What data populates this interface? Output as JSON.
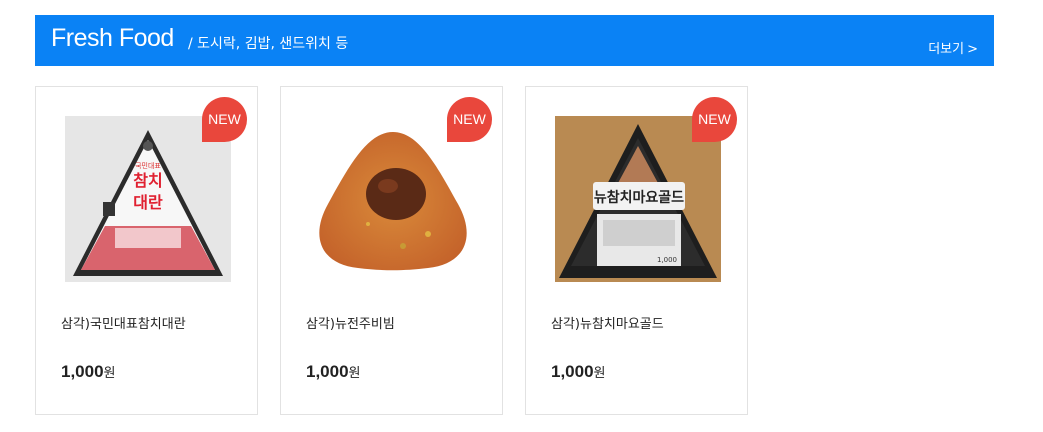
{
  "header": {
    "title": "Fresh Food",
    "subtitle": "/ 도시락, 김밥, 샌드위치 등",
    "more_label": "더보기",
    "more_chevron": ">"
  },
  "colors": {
    "header_bg": "#0a82f5",
    "badge_bg": "#e9473c"
  },
  "products": [
    {
      "badge": "NEW",
      "image_text_top": "국민대표",
      "image_text_main": "참치",
      "image_text_sub": "대란",
      "name": "삼각)국민대표참치대란",
      "price": "1,000",
      "currency": "원"
    },
    {
      "badge": "NEW",
      "name": "삼각)뉴전주비빔",
      "price": "1,000",
      "currency": "원"
    },
    {
      "badge": "NEW",
      "image_text_main": "뉴참치마요골드",
      "image_price": "1,000",
      "name": "삼각)뉴참치마요골드",
      "price": "1,000",
      "currency": "원"
    }
  ]
}
